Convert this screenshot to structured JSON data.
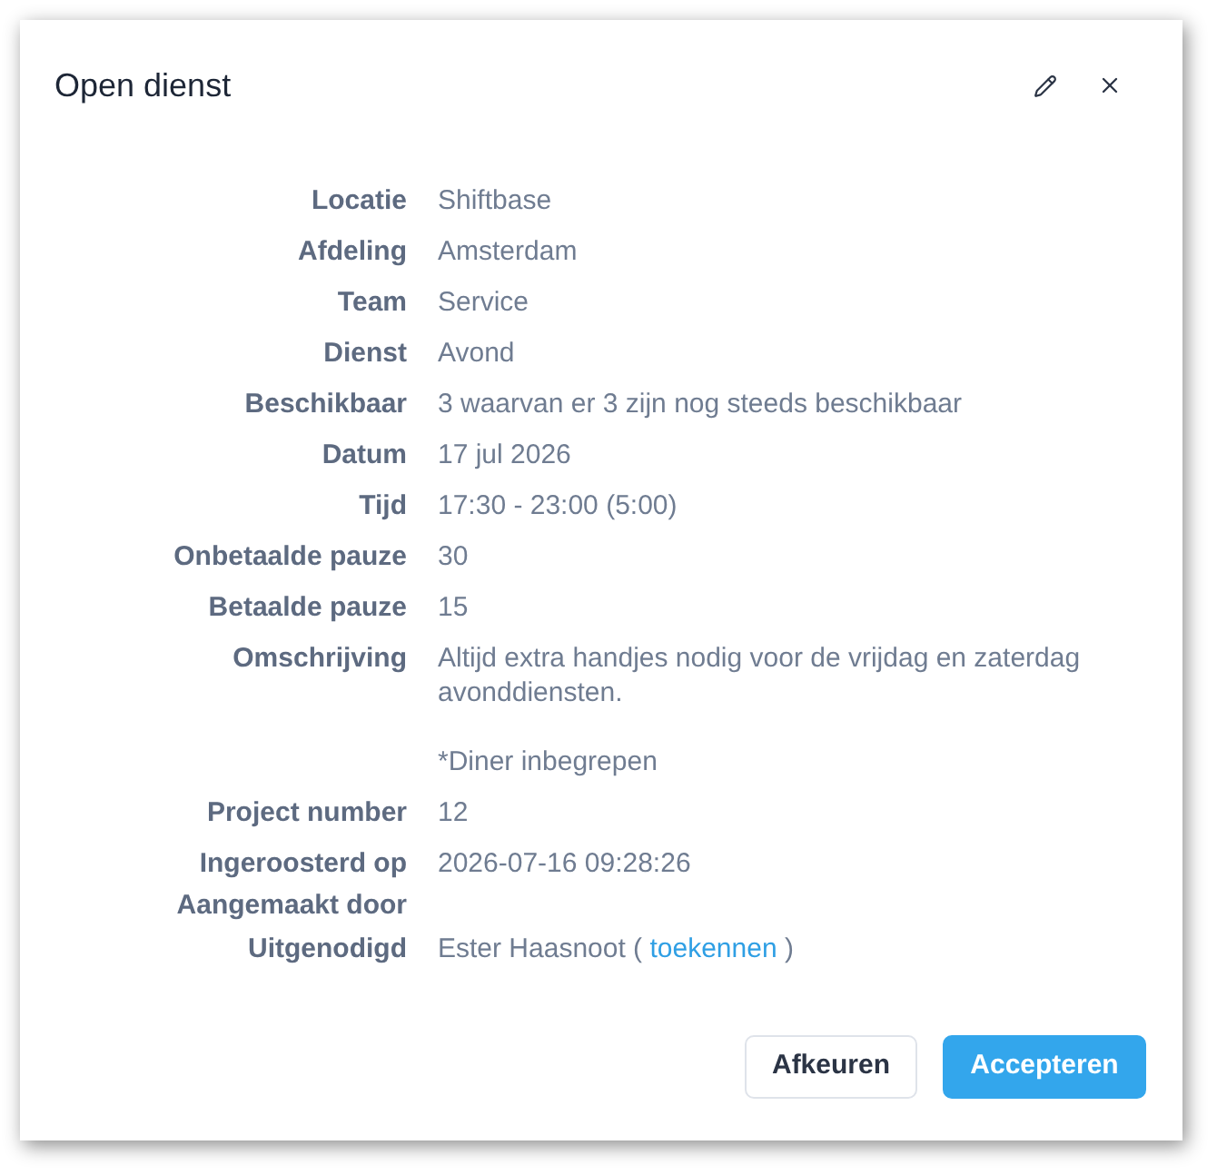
{
  "dialog": {
    "title": "Open dienst"
  },
  "fields": [
    {
      "kind": "text",
      "label": "Locatie",
      "value": "Shiftbase"
    },
    {
      "kind": "text",
      "label": "Afdeling",
      "value": "Amsterdam"
    },
    {
      "kind": "text",
      "label": "Team",
      "value": "Service"
    },
    {
      "kind": "text",
      "label": "Dienst",
      "value": "Avond"
    },
    {
      "kind": "text",
      "label": "Beschikbaar",
      "value": "3 waarvan er 3 zijn nog steeds beschikbaar"
    },
    {
      "kind": "text",
      "label": "Datum",
      "value": "17 jul 2026"
    },
    {
      "kind": "text",
      "label": "Tijd",
      "value": "17:30 - 23:00 (5:00)"
    },
    {
      "kind": "text",
      "label": "Onbetaalde pauze",
      "value": "30"
    },
    {
      "kind": "text",
      "label": "Betaalde pauze",
      "value": "15"
    },
    {
      "kind": "paragraphs",
      "label": "Omschrijving",
      "paragraphs": [
        "Altijd extra handjes nodig voor de vrijdag en zaterdag avonddiensten.",
        "*Diner inbegrepen"
      ]
    },
    {
      "kind": "text",
      "label": "Project number",
      "value": "12"
    },
    {
      "kind": "text",
      "label": "Ingeroosterd op",
      "value": "2026-07-16 09:28:26"
    },
    {
      "kind": "empty",
      "label": "Aangemaakt door"
    },
    {
      "kind": "invite",
      "label": "Uitgenodigd",
      "prefix": "Ester Haasnoot (",
      "link": "toekennen",
      "suffix": ")"
    }
  ],
  "buttons": [
    {
      "kind": "secondary",
      "label": "Afkeuren"
    },
    {
      "kind": "primary",
      "label": "Accepteren"
    }
  ]
}
